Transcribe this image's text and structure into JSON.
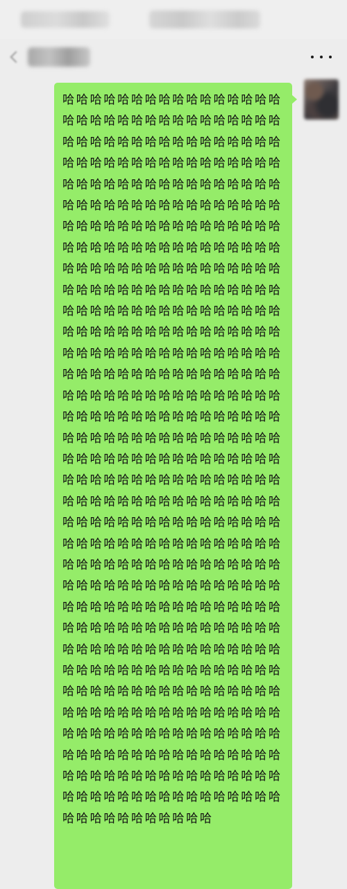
{
  "status_bar": {
    "left_text": "",
    "right_text": ""
  },
  "nav": {
    "title": "",
    "more_label": "•••"
  },
  "chat": {
    "messages": [
      {
        "sender": "self",
        "text": "哈哈哈哈哈哈哈哈哈哈哈哈哈哈哈哈哈哈哈哈哈哈哈哈哈哈哈哈哈哈哈哈哈哈哈哈哈哈哈哈哈哈哈哈哈哈哈哈哈哈哈哈哈哈哈哈哈哈哈哈哈哈哈哈哈哈哈哈哈哈哈哈哈哈哈哈哈哈哈哈哈哈哈哈哈哈哈哈哈哈哈哈哈哈哈哈哈哈哈哈哈哈哈哈哈哈哈哈哈哈哈哈哈哈哈哈哈哈哈哈哈哈哈哈哈哈哈哈哈哈哈哈哈哈哈哈哈哈哈哈哈哈哈哈哈哈哈哈哈哈哈哈哈哈哈哈哈哈哈哈哈哈哈哈哈哈哈哈哈哈哈哈哈哈哈哈哈哈哈哈哈哈哈哈哈哈哈哈哈哈哈哈哈哈哈哈哈哈哈哈哈哈哈哈哈哈哈哈哈哈哈哈哈哈哈哈哈哈哈哈哈哈哈哈哈哈哈哈哈哈哈哈哈哈哈哈哈哈哈哈哈哈哈哈哈哈哈哈哈哈哈哈哈哈哈哈哈哈哈哈哈哈哈哈哈哈哈哈哈哈哈哈哈哈哈哈哈哈哈哈哈哈哈哈哈哈哈哈哈哈哈哈哈哈哈哈哈哈哈哈哈哈哈哈哈哈哈哈哈哈哈哈哈哈哈哈哈哈哈哈哈哈哈哈哈哈哈哈哈哈哈哈哈哈哈哈哈哈哈哈哈哈哈哈哈哈哈哈哈哈哈哈哈哈哈哈哈哈哈哈哈哈哈哈哈哈哈哈哈哈哈哈哈哈哈哈哈哈哈哈哈哈哈哈哈哈哈哈哈哈哈哈哈哈哈哈哈哈哈哈哈哈哈哈哈哈哈哈哈哈哈哈哈哈哈哈哈哈哈哈哈哈哈哈哈哈哈哈哈哈哈哈哈哈哈哈哈哈哈哈哈哈哈哈哈哈哈哈哈哈哈哈哈哈哈哈哈哈哈哈哈哈哈哈哈哈哈哈哈哈哈哈哈哈哈哈哈哈哈哈哈哈哈哈哈哈哈哈哈哈哈哈哈哈哈哈哈哈哈哈哈哈哈哈哈哈哈哈哈哈哈哈哈哈哈哈哈哈哈哈哈哈哈哈哈哈哈哈哈哈哈哈哈哈哈哈哈哈哈哈哈哈哈哈哈哈哈哈哈哈哈哈哈哈哈"
      }
    ]
  },
  "colors": {
    "background": "#ededed",
    "bubble_self": "#95ec69",
    "text": "#111111"
  }
}
